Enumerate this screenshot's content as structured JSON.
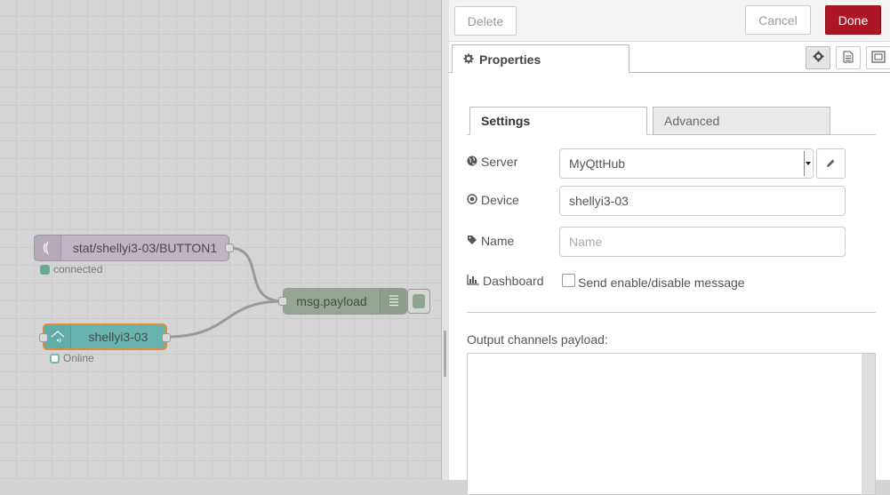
{
  "flow": {
    "nodes": {
      "mqtt_in": {
        "label": "stat/shellyi3-03/BUTTON1",
        "status": "connected",
        "icon": "wifi-waves-icon",
        "color": "#c0b3c3"
      },
      "shelly": {
        "label": "shellyi3-03",
        "status": "Online",
        "icon": "home-wifi-icon",
        "color": "#68b5b0"
      },
      "debug": {
        "label": "msg.payload",
        "icon": "list-lines-icon",
        "color": "#94a792"
      }
    },
    "status_colors": {
      "connected": "#6ca897",
      "online": "#7fb3b0"
    }
  },
  "toolbar": {
    "delete_label": "Delete",
    "cancel_label": "Cancel",
    "done_label": "Done",
    "done_color": "#ad1625"
  },
  "tabs": {
    "properties_label": "Properties",
    "settings_label": "Settings",
    "advanced_label": "Advanced"
  },
  "form": {
    "server_label": "Server",
    "server_value": "MyQttHub",
    "device_label": "Device",
    "device_value": "shellyi3-03",
    "name_label": "Name",
    "name_placeholder": "Name",
    "dashboard_label": "Dashboard",
    "dashboard_checkbox_label": "Send enable/disable message",
    "output_label": "Output channels payload:"
  }
}
